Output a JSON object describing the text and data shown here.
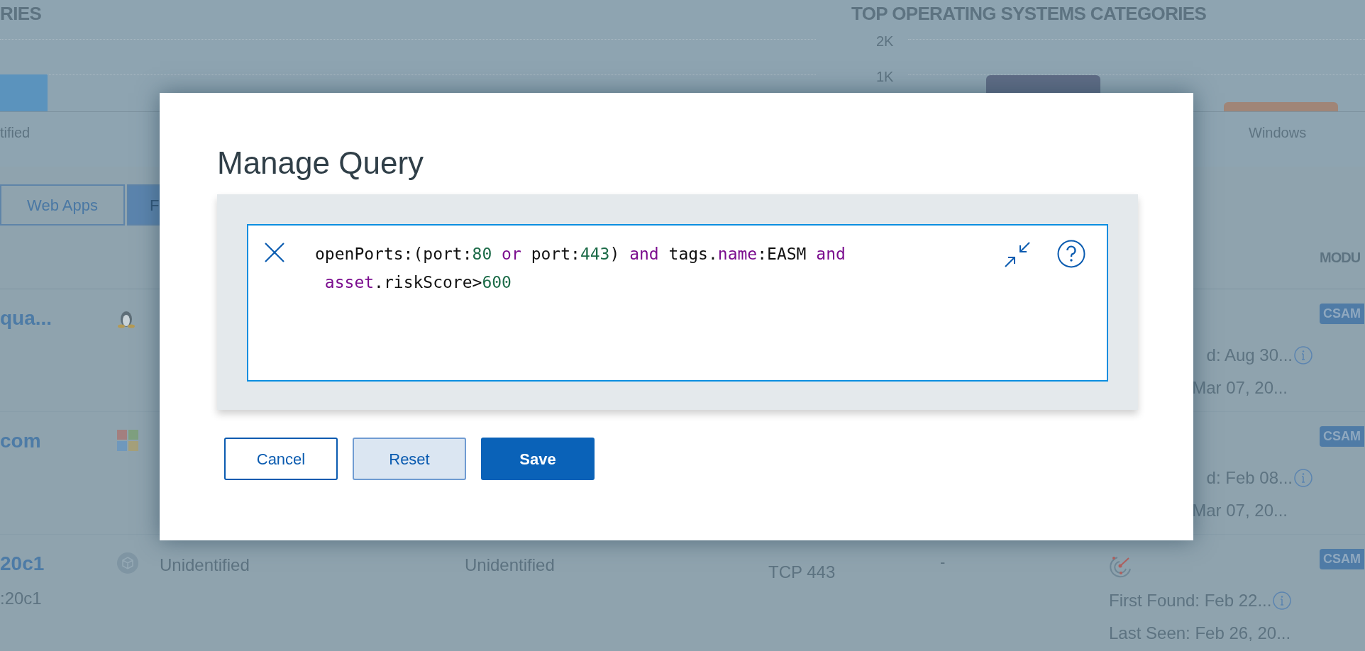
{
  "charts": [
    {
      "title": "RIES",
      "bars": [
        {
          "label": "tified",
          "color": "#5b93bd"
        }
      ]
    },
    {
      "title": "TOP OPERATING SYSTEMS CATEGORIES",
      "yticks": [
        "2K",
        "1K"
      ],
      "bars": [
        {
          "color": "#5f6c85"
        },
        {
          "label": "Windows",
          "color": "#a08577"
        }
      ]
    }
  ],
  "tabs": [
    {
      "label": "Web Apps",
      "selected": false
    },
    {
      "label": "F",
      "selected": true
    }
  ],
  "table": {
    "header": "MODU",
    "rows": [
      {
        "name": "qua...",
        "sub": "",
        "os_icon": {
          "kind": "linux"
        },
        "os": "",
        "category": "",
        "ports": "",
        "col_6": "",
        "scan_icon": false,
        "first_found": "d: Aug 30...",
        "last_seen": "Mar 07, 20...",
        "module": "CSAM"
      },
      {
        "name": "com",
        "sub": "",
        "os_icon": {
          "kind": "windows"
        },
        "os": "",
        "category": "",
        "ports": "",
        "col_6": "",
        "scan_icon": false,
        "first_found": "d: Feb 08...",
        "last_seen": "Mar 07, 20...",
        "module": "CSAM"
      },
      {
        "name": "20c1",
        "sub": ":20c1",
        "os_icon": {
          "kind": "unknown"
        },
        "os": "Unidentified",
        "category": "Unidentified",
        "ports": "TCP 443",
        "col_6": "-",
        "scan_icon": true,
        "first_found": "First Found: Feb 22...",
        "last_seen": "Last Seen: Feb 26, 20...",
        "module": "CSAM"
      }
    ]
  },
  "dialog": {
    "title": "Manage Query",
    "query_lines": [
      [
        {
          "kind": "plain",
          "text": "openPorts:(port:"
        },
        {
          "kind": "number",
          "text": "80"
        },
        {
          "kind": "keyword",
          "text": " or "
        },
        {
          "kind": "plain",
          "text": "port:"
        },
        {
          "kind": "number",
          "text": "443"
        },
        {
          "kind": "plain",
          "text": ") "
        },
        {
          "kind": "keyword",
          "text": "and"
        },
        {
          "kind": "plain",
          "text": " tags."
        },
        {
          "kind": "keyword",
          "text": "name"
        },
        {
          "kind": "plain",
          "text": ":EASM "
        },
        {
          "kind": "keyword",
          "text": "and"
        }
      ],
      [
        {
          "kind": "keyword",
          "text": " asset"
        },
        {
          "kind": "plain",
          "text": ".riskScore>"
        },
        {
          "kind": "number",
          "text": "600"
        }
      ]
    ],
    "buttons": [
      {
        "label": "Cancel",
        "kind": "outline"
      },
      {
        "label": "Reset",
        "kind": "soft"
      },
      {
        "label": "Save",
        "kind": "primary"
      }
    ]
  }
}
